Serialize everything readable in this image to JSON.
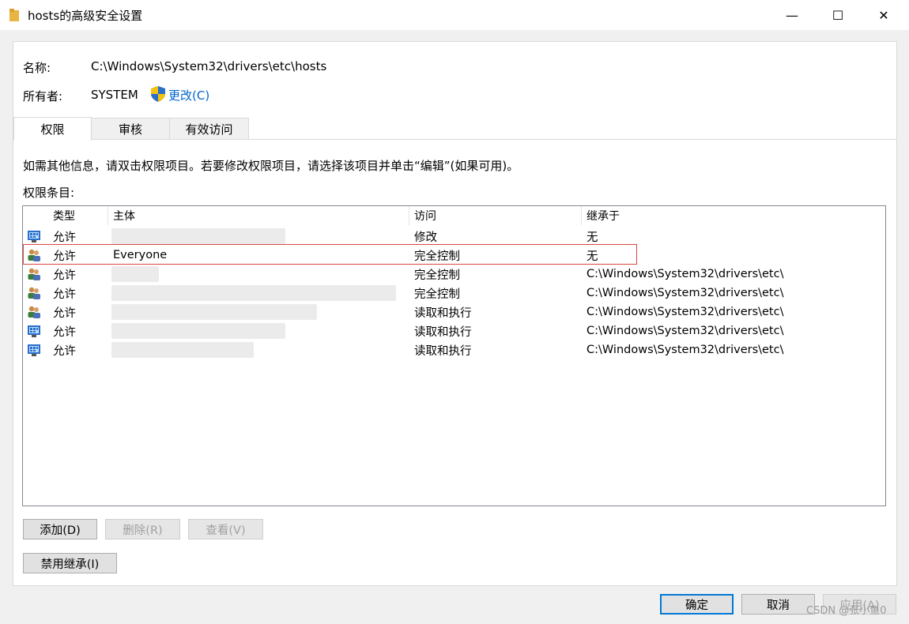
{
  "window": {
    "title": "hosts的高级安全设置",
    "minimize": "—",
    "maximize": "☐",
    "close": "✕"
  },
  "info": {
    "name_label": "名称:",
    "name_value": "C:\\Windows\\System32\\drivers\\etc\\hosts",
    "owner_label": "所有者:",
    "owner_value": "SYSTEM",
    "change_link": "更改(C)"
  },
  "tabs": [
    {
      "label": "权限",
      "active": true
    },
    {
      "label": "审核",
      "active": false
    },
    {
      "label": "有效访问",
      "active": false
    }
  ],
  "instructions": "如需其他信息，请双击权限项目。若要修改权限项目，请选择该项目并单击“编辑”(如果可用)。",
  "list_title": "权限条目:",
  "columns": [
    "类型",
    "主体",
    "访问",
    "继承于"
  ],
  "rows": [
    {
      "icon": "computer-group-icon",
      "type": "允许",
      "principal": "",
      "access": "修改",
      "inherited": "无"
    },
    {
      "icon": "users-icon",
      "type": "允许",
      "principal": "Everyone",
      "access": "完全控制",
      "inherited": "无"
    },
    {
      "icon": "users-icon",
      "type": "允许",
      "principal": "",
      "access": "完全控制",
      "inherited": "C:\\Windows\\System32\\drivers\\etc\\"
    },
    {
      "icon": "users-icon",
      "type": "允许",
      "principal": "",
      "access": "完全控制",
      "inherited": "C:\\Windows\\System32\\drivers\\etc\\"
    },
    {
      "icon": "users-icon",
      "type": "允许",
      "principal": "",
      "access": "读取和执行",
      "inherited": "C:\\Windows\\System32\\drivers\\etc\\"
    },
    {
      "icon": "computer-group-icon",
      "type": "允许",
      "principal": "",
      "access": "读取和执行",
      "inherited": "C:\\Windows\\System32\\drivers\\etc\\"
    },
    {
      "icon": "computer-group-icon",
      "type": "允许",
      "principal": "",
      "access": "读取和执行",
      "inherited": "C:\\Windows\\System32\\drivers\\etc\\"
    }
  ],
  "buttons": {
    "add": "添加(D)",
    "remove": "删除(R)",
    "view": "查看(V)",
    "disable_inheritance": "禁用继承(I)",
    "ok": "确定",
    "cancel": "取消",
    "apply": "应用(A)"
  },
  "watermark": "CSDN @张小鱼0",
  "colors": {
    "link": "#0066cc",
    "highlight_border": "#d9463f",
    "default_button_border": "#0078d7"
  }
}
